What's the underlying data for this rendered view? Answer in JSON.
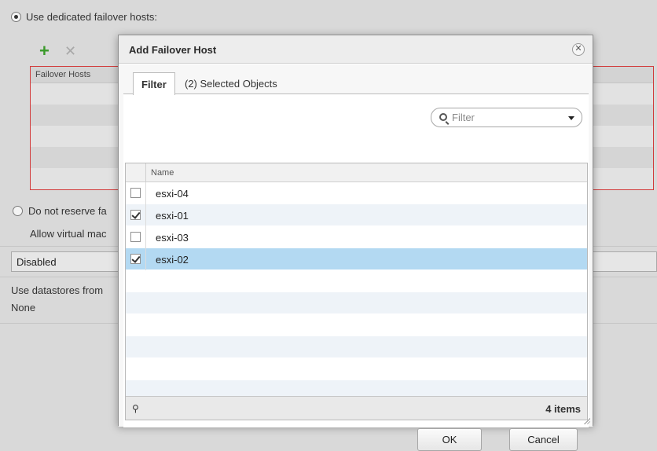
{
  "background": {
    "option_dedicated": "Use dedicated failover hosts:",
    "failover_hosts_header": "Failover Hosts",
    "option_do_not_reserve": "Do not reserve fa",
    "allow_vm_text": "Allow virtual mac",
    "select_value": "Disabled",
    "datastores_text": "Use datastores from",
    "datastores_value": "None"
  },
  "dialog": {
    "title": "Add Failover Host",
    "close_icon": "close-icon",
    "tabs": [
      {
        "label": "Filter",
        "active": true
      },
      {
        "label": "(2) Selected Objects",
        "active": false
      }
    ],
    "filter": {
      "placeholder": "Filter",
      "value": ""
    },
    "grid": {
      "column_name": "Name",
      "rows": [
        {
          "name": "esxi-04",
          "checked": false,
          "selected": false
        },
        {
          "name": "esxi-01",
          "checked": true,
          "selected": false
        },
        {
          "name": "esxi-03",
          "checked": false,
          "selected": false
        },
        {
          "name": "esxi-02",
          "checked": true,
          "selected": true
        }
      ],
      "footer_count": "4 items"
    },
    "ok_label": "OK",
    "cancel_label": "Cancel"
  },
  "colors": {
    "selected_row": "#b3d9f2",
    "alt_row": "#eef3f8",
    "error_border": "#d23b3b",
    "add_icon": "#3a9a2a"
  }
}
